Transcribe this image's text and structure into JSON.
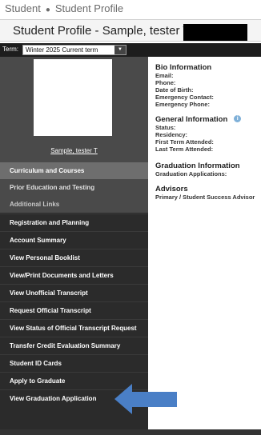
{
  "breadcrumb": {
    "item1": "Student",
    "separator": "●",
    "item2": "Student Profile"
  },
  "page_title": "Student Profile - Sample, tester T",
  "term": {
    "label": "Term:",
    "selected": "Winter 2025 Current term",
    "arrow_icon": "chevron-down-icon"
  },
  "student_name": "Sample, tester T",
  "nav": {
    "sections": [
      "Curriculum and Courses",
      "Prior Education and Testing",
      "Additional Links"
    ],
    "items": [
      "Registration and Planning",
      "Account Summary",
      "View Personal Booklist",
      "View/Print Documents and Letters",
      "View Unofficial Transcript",
      "Request Official Transcript",
      "View Status of Official Transcript Request",
      "Transfer Credit Evaluation Summary",
      "Student ID Cards",
      "Apply to Graduate",
      "View Graduation Application"
    ]
  },
  "bio": {
    "title": "Bio Information",
    "fields": [
      "Email:",
      "Phone:",
      "Date of Birth:",
      "Emergency Contact:",
      "Emergency Phone:"
    ]
  },
  "general": {
    "title": "General Information",
    "info_icon": "i",
    "fields": [
      "Status:",
      "Residency:",
      "First Term Attended:",
      "Last Term Attended:"
    ]
  },
  "graduation": {
    "title": "Graduation Information",
    "fields": [
      "Graduation Applications:"
    ]
  },
  "advisors": {
    "title": "Advisors",
    "fields": [
      "Primary / Student Success Advisor"
    ]
  },
  "colors": {
    "sidebar": "#2b2b2b",
    "arrow": "#4a7fc6",
    "section_highlight": "#6e6e6e"
  }
}
